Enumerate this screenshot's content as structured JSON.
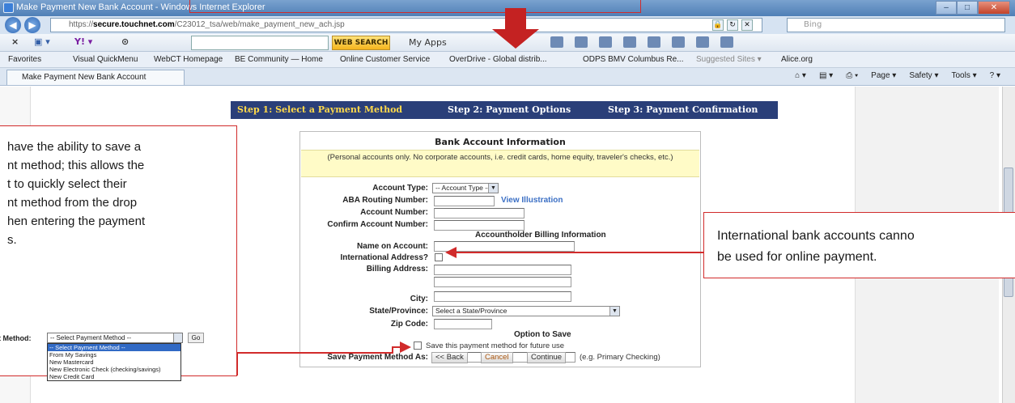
{
  "browser": {
    "window_title": "Make Payment New Bank Account - Windows Internet Explorer",
    "url_prefix": "https://",
    "url_host": "secure.touchnet.com",
    "url_path": "/C23012_tsa/web/make_payment_new_ach.jsp",
    "search_placeholder": "Bing",
    "tab_title": "Make Payment New Bank Account",
    "toolbar": {
      "close_x": "×",
      "web_search": "WEB SEARCH",
      "my_apps": "My Apps"
    },
    "favorites": [
      "Favorites",
      "Visual QuickMenu",
      "WebCT Homepage",
      "BE Community — Home",
      "Online Customer Service",
      "OverDrive - Global distrib...",
      "ODPS BMV Columbus Re...",
      "Suggested Sites ▾",
      "Alice.org"
    ],
    "commands": [
      "Page ▾",
      "Safety ▾",
      "Tools ▾"
    ]
  },
  "steps": {
    "step1": "Step 1: Select a Payment Method",
    "step2": "Step 2: Payment Options",
    "step3": "Step 3: Payment Confirmation"
  },
  "form": {
    "title": "Bank Account Information",
    "notice": "(Personal accounts only. No corporate accounts, i.e. credit cards, home equity, traveler's checks, etc.)",
    "account_type_label": "Account Type:",
    "account_type_value": "-- Account Type --",
    "aba_label": "ABA Routing Number:",
    "view_illustration": "View Illustration",
    "account_number_label": "Account Number:",
    "confirm_account_label": "Confirm Account Number:",
    "billing_section": "Accountholder Billing Information",
    "name_label": "Name on Account:",
    "intl_label": "International Address?",
    "billing_address_label": "Billing Address:",
    "city_label": "City:",
    "state_label": "State/Province:",
    "state_value": "Select a State/Province",
    "zip_label": "Zip Code:",
    "option_section": "Option to Save",
    "save_checkbox_label": "Save this payment method for future use",
    "save_as_label": "Save Payment Method As:",
    "save_as_hint": "(e.g. Primary Checking)",
    "back_button": "<< Back",
    "cancel_button": "Cancel",
    "continue_button": "Continue"
  },
  "annotations": {
    "left_lines": [
      "have the ability to save a",
      "nt method; this allows the",
      "t to quickly select their",
      "nt method from the drop",
      "hen entering the payment",
      "s."
    ],
    "right_lines": [
      "International bank accounts canno",
      "be used for online payment."
    ],
    "mini": {
      "label": "t Method:",
      "select_value": "-- Select Payment Method --",
      "go": "Go",
      "options": [
        "-- Select Payment Method --",
        "From My Savings",
        "New Mastercard",
        "New Electronic Check (checking/savings)",
        "New Credit Card"
      ]
    }
  },
  "colors": {
    "step_bar": "#2a3f79",
    "step_active": "#ffd94a",
    "annotation_red": "#d12b2b",
    "notice_bg": "#fffbc7"
  }
}
